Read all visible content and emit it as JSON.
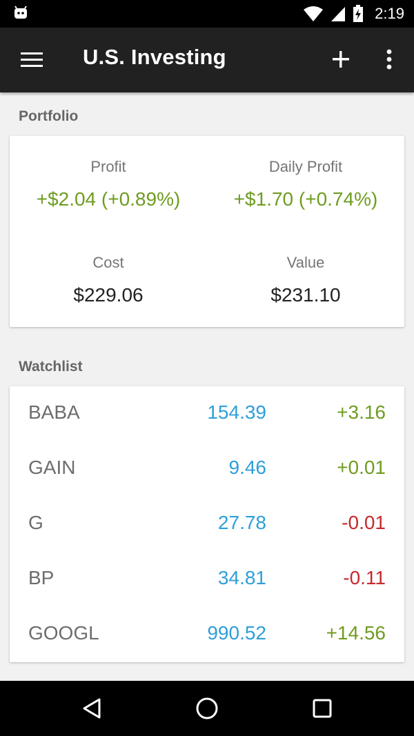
{
  "status_bar": {
    "time": "2:19",
    "icons": [
      "android-icon",
      "wifi-icon",
      "signal-icon",
      "battery-icon"
    ]
  },
  "app_bar": {
    "title": "U.S. Investing",
    "icons": [
      "menu-icon",
      "add-icon",
      "more-vert-icon"
    ]
  },
  "portfolio": {
    "header": "Portfolio",
    "profit": {
      "label": "Profit",
      "value": "+$2.04 (+0.89%)"
    },
    "daily_profit": {
      "label": "Daily Profit",
      "value": "+$1.70 (+0.74%)"
    },
    "cost": {
      "label": "Cost",
      "value": "$229.06"
    },
    "value": {
      "label": "Value",
      "value": "$231.10"
    }
  },
  "watchlist": {
    "header": "Watchlist",
    "rows": [
      {
        "symbol": "BABA",
        "price": "154.39",
        "change": "+3.16",
        "direction": "up"
      },
      {
        "symbol": "GAIN",
        "price": "9.46",
        "change": "+0.01",
        "direction": "up"
      },
      {
        "symbol": "G",
        "price": "27.78",
        "change": "-0.01",
        "direction": "down"
      },
      {
        "symbol": "BP",
        "price": "34.81",
        "change": "-0.11",
        "direction": "down"
      },
      {
        "symbol": "GOOGL",
        "price": "990.52",
        "change": "+14.56",
        "direction": "up"
      }
    ]
  },
  "colors": {
    "positive": "#6f9c21",
    "negative": "#c6282c",
    "price": "#2d9fd9",
    "app_bar": "#212121"
  },
  "nav_bar": {
    "icons": [
      "back-icon",
      "home-icon",
      "recents-icon"
    ]
  }
}
